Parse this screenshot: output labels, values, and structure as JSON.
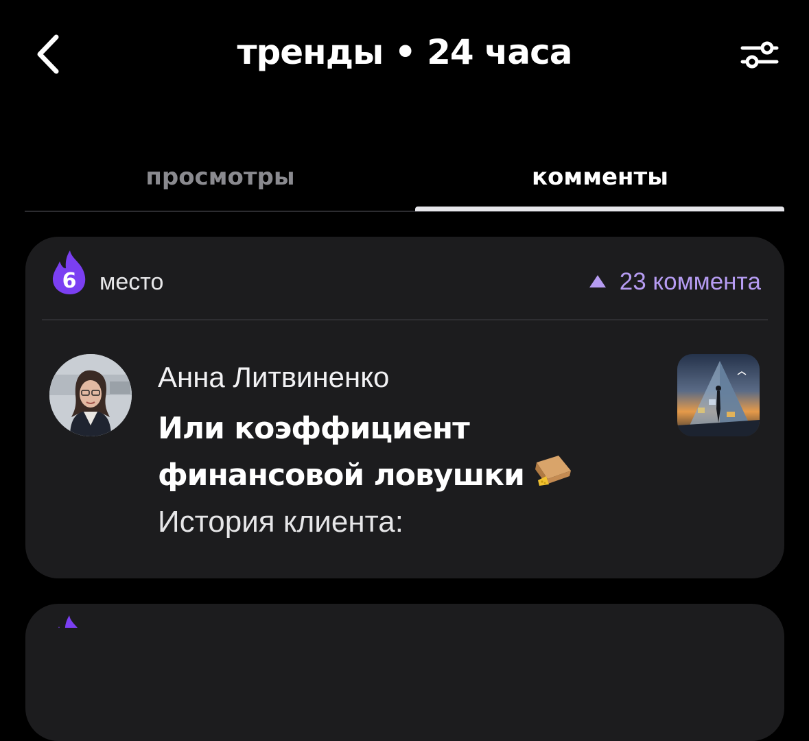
{
  "header": {
    "title": "тренды • 24 часа",
    "back_icon": "chevron-left-icon",
    "filter_icon": "sliders-icon"
  },
  "tabs": [
    {
      "label": "просмотры",
      "active": false
    },
    {
      "label": "комменты",
      "active": true
    }
  ],
  "colors": {
    "accent": "#b69cf2",
    "flame": "#7b3ff2",
    "card_bg": "#1c1c1e",
    "background": "#000000"
  },
  "card": {
    "rank": "6",
    "rank_label": "место",
    "rank_icon": "flame-icon",
    "comment_count_label": "23 комментa",
    "author": "Анна Литвиненко",
    "title": "Или коэффициент финансовой ловушки",
    "title_emoji": "mouse-trap-icon",
    "excerpt": "История клиента:",
    "thumbnail": "pyramid-image"
  }
}
